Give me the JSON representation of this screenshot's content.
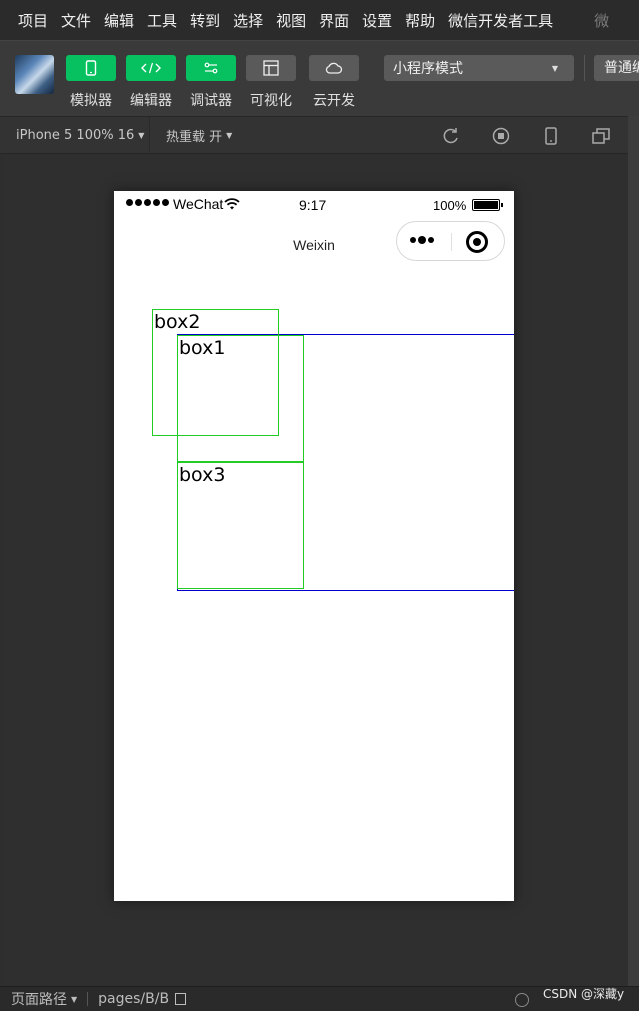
{
  "menubar": {
    "items": [
      "项目",
      "文件",
      "编辑",
      "工具",
      "转到",
      "选择",
      "视图",
      "界面",
      "设置",
      "帮助",
      "微信开发者工具"
    ],
    "overflow_label": "微"
  },
  "toolbar": {
    "tools": [
      {
        "label": "模拟器",
        "icon": "phone-icon",
        "active": true
      },
      {
        "label": "编辑器",
        "icon": "code-icon",
        "active": true
      },
      {
        "label": "调试器",
        "icon": "debug-toggle-icon",
        "active": true
      },
      {
        "label": "可视化",
        "icon": "layout-icon",
        "active": false
      },
      {
        "label": "云开发",
        "icon": "cloud-icon",
        "active": false
      }
    ],
    "mode_select": "小程序模式",
    "compile_select": "普通编"
  },
  "simbar": {
    "device": "iPhone 5 100% 16",
    "hot_reload": "热重载 开"
  },
  "phone": {
    "carrier": "WeChat",
    "time": "9:17",
    "battery": "100%",
    "nav_title": "Weixin"
  },
  "boxes": {
    "box1": "box1",
    "box2": "box2",
    "box3": "box3"
  },
  "bottombar": {
    "path_label": "页面路径",
    "path_value": "pages/B/B"
  },
  "watermark": "CSDN @深藏y",
  "colors": {
    "accent_green": "#07c160",
    "box_border": "#22cc22",
    "container_border": "#0000cc"
  }
}
